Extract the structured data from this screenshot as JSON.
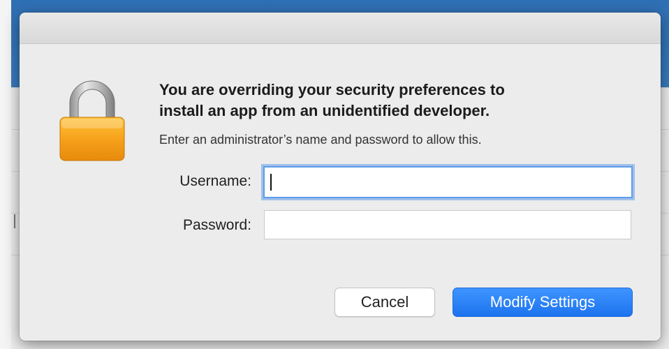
{
  "dialog": {
    "title_line1": "You are overriding your security preferences to",
    "title_line2": "install an app from an unidentified developer.",
    "subtitle": "Enter an administrator’s name and password to allow this.",
    "username_label": "Username:",
    "username_value": "",
    "password_label": "Password:",
    "password_value": "",
    "cancel_label": "Cancel",
    "modify_label": "Modify Settings",
    "icon": "lock-icon"
  },
  "colors": {
    "accent": "#1c73ee",
    "lock_body": "#f3a11a",
    "focus_ring": "#5e9bea"
  }
}
